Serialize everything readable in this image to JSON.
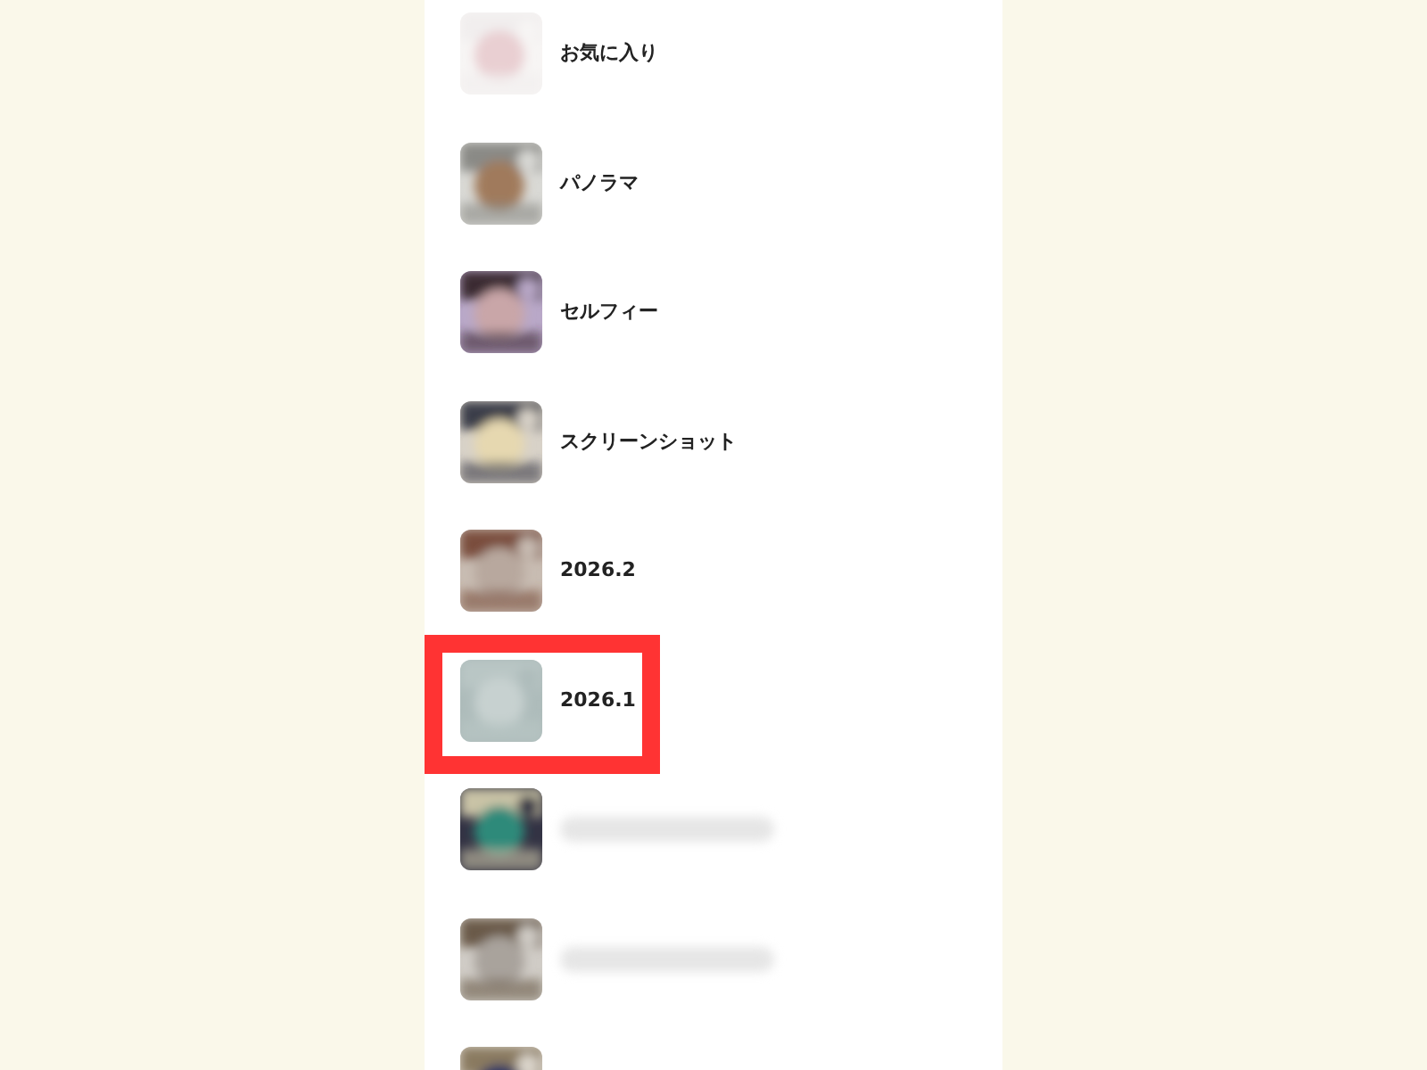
{
  "albums": [
    {
      "kind": "label",
      "title": "お気に入り",
      "highlighted": false
    },
    {
      "kind": "label",
      "title": "パノラマ",
      "highlighted": false
    },
    {
      "kind": "label",
      "title": "セルフィー",
      "highlighted": false
    },
    {
      "kind": "label",
      "title": "スクリーンショット",
      "highlighted": false
    },
    {
      "kind": "label",
      "title": "2026.2",
      "highlighted": false
    },
    {
      "kind": "label",
      "title": "2026.1",
      "highlighted": true
    },
    {
      "kind": "blurred",
      "highlighted": false
    },
    {
      "kind": "blurred",
      "highlighted": false
    },
    {
      "kind": "thumbnail",
      "highlighted": false
    }
  ]
}
